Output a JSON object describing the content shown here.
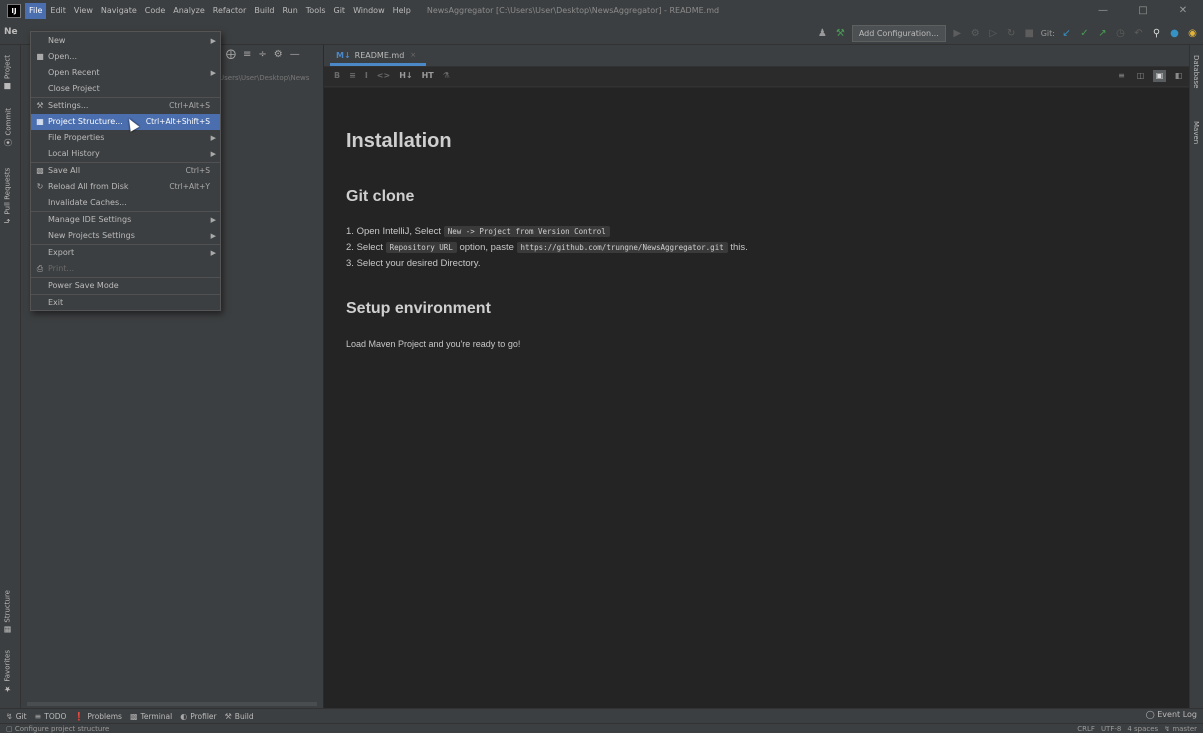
{
  "app": {
    "logo": "IJ",
    "window_title": "NewsAggregator [C:\\Users\\User\\Desktop\\NewsAggregator] - README.md"
  },
  "menubar": [
    "File",
    "Edit",
    "View",
    "Navigate",
    "Code",
    "Analyze",
    "Refactor",
    "Build",
    "Run",
    "Tools",
    "Git",
    "Window",
    "Help"
  ],
  "window_controls": {
    "minimize": "—",
    "maximize": "□",
    "close": "✕"
  },
  "toolbar": {
    "nav_label": "Ne",
    "add_configuration": "Add Configuration...",
    "git_label": "Git:"
  },
  "left_stripe": {
    "project": "Project",
    "commit": "Commit",
    "pull_requests": "Pull Requests",
    "structure": "Structure",
    "favorites": "Favorites"
  },
  "right_stripe": {
    "database": "Database",
    "maven": "Maven"
  },
  "project_panel": {
    "path": "Users\\User\\Desktop\\News"
  },
  "editor": {
    "tab_label": "README.md",
    "tab_close": "×",
    "md_tools": [
      "B",
      "≡",
      "I",
      "<>",
      "H↓",
      "HT",
      "⚗"
    ]
  },
  "preview": {
    "h1": "Installation",
    "h2_git": "Git clone",
    "steps": [
      {
        "num": "1.",
        "before": "Open IntelliJ, Select",
        "code": "New -> Project from Version Control",
        "mid": "",
        "code2": "",
        "after": ""
      },
      {
        "num": "2.",
        "before": "Select",
        "code": "Repository URL",
        "mid": "option, paste",
        "code2": "https://github.com/trungne/NewsAggregator.git",
        "after": "this."
      },
      {
        "num": "3.",
        "before": "Select your desired Directory.",
        "code": "",
        "mid": "",
        "code2": "",
        "after": ""
      }
    ],
    "h2_setup": "Setup environment",
    "p_load": "Load Maven Project and you're ready to go!"
  },
  "file_menu": {
    "new": "New",
    "open": "Open...",
    "open_recent": "Open Recent",
    "close_project": "Close Project",
    "settings": "Settings...",
    "settings_sc": "Ctrl+Alt+S",
    "project_structure": "Project Structure...",
    "project_structure_sc": "Ctrl+Alt+Shift+S",
    "file_properties": "File Properties",
    "local_history": "Local History",
    "save_all": "Save All",
    "save_all_sc": "Ctrl+S",
    "reload": "Reload All from Disk",
    "reload_sc": "Ctrl+Alt+Y",
    "invalidate": "Invalidate Caches...",
    "manage_ide": "Manage IDE Settings",
    "new_projects_settings": "New Projects Settings",
    "export": "Export",
    "print": "Print...",
    "power_save": "Power Save Mode",
    "exit": "Exit"
  },
  "bottom_tools": {
    "git": "Git",
    "todo": "TODO",
    "problems": "Problems",
    "terminal": "Terminal",
    "profiler": "Profiler",
    "build": "Build",
    "event_log": "Event Log"
  },
  "status": {
    "message": "Configure project structure",
    "line_sep": "CRLF",
    "encoding": "UTF-8",
    "indent": "4 spaces",
    "branch": "master"
  },
  "colors": {
    "accent": "#4b6eaf",
    "background": "#2b2b2b",
    "panel": "#3c3f41",
    "preview": "#242424"
  }
}
